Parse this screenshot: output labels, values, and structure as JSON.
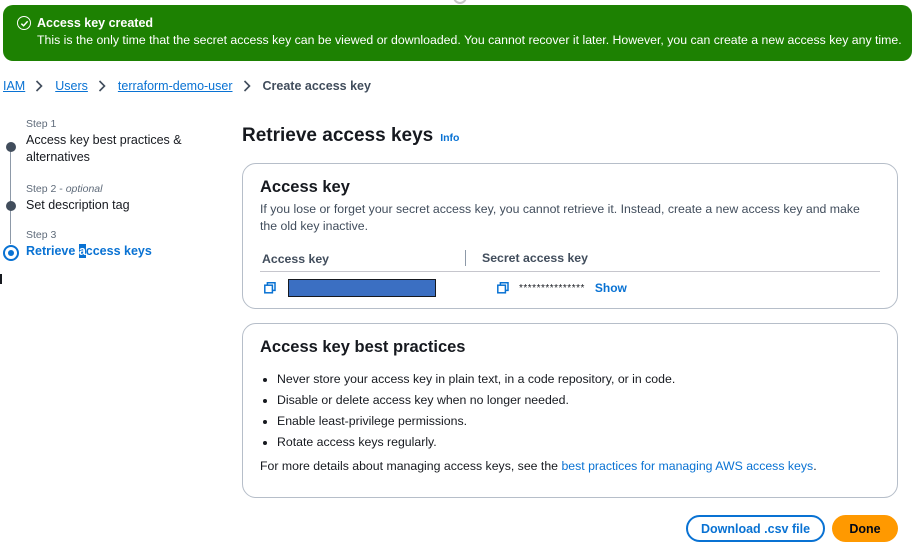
{
  "banner": {
    "title": "Access key created",
    "message": "This is the only time that the secret access key can be viewed or downloaded. You cannot recover it later. However, you can create a new access key any time.",
    "color": "#1d8102"
  },
  "breadcrumb": {
    "items": [
      "IAM",
      "Users",
      "terraform-demo-user"
    ],
    "current": "Create access key"
  },
  "steps": [
    {
      "number": "Step 1",
      "title": "Access key best practices & alternatives"
    },
    {
      "number": "Step 2",
      "optional": "optional",
      "title": "Set description tag"
    },
    {
      "number": "Step 3",
      "title_a": "Retrieve ",
      "title_cursor": "a",
      "title_b": "ccess keys"
    }
  ],
  "page": {
    "title": "Retrieve access keys",
    "info": "Info"
  },
  "access_key_card": {
    "title": "Access key",
    "description": "If you lose or forget your secret access key, you cannot retrieve it. Instead, create a new access key and make the old key inactive.",
    "col_access_key": "Access key",
    "col_secret": "Secret access key",
    "secret_mask": "***************",
    "show": "Show"
  },
  "best_practices": {
    "title": "Access key best practices",
    "items": [
      "Never store your access key in plain text, in a code repository, or in code.",
      "Disable or delete access key when no longer needed.",
      "Enable least-privilege permissions.",
      "Rotate access keys regularly."
    ],
    "more_prefix": "For more details about managing access keys, see the ",
    "more_link": "best practices for managing AWS access keys",
    "more_suffix": "."
  },
  "buttons": {
    "download": "Download .csv file",
    "done": "Done"
  },
  "colors": {
    "accent": "#0972d3",
    "primary_button": "#ff9900"
  }
}
